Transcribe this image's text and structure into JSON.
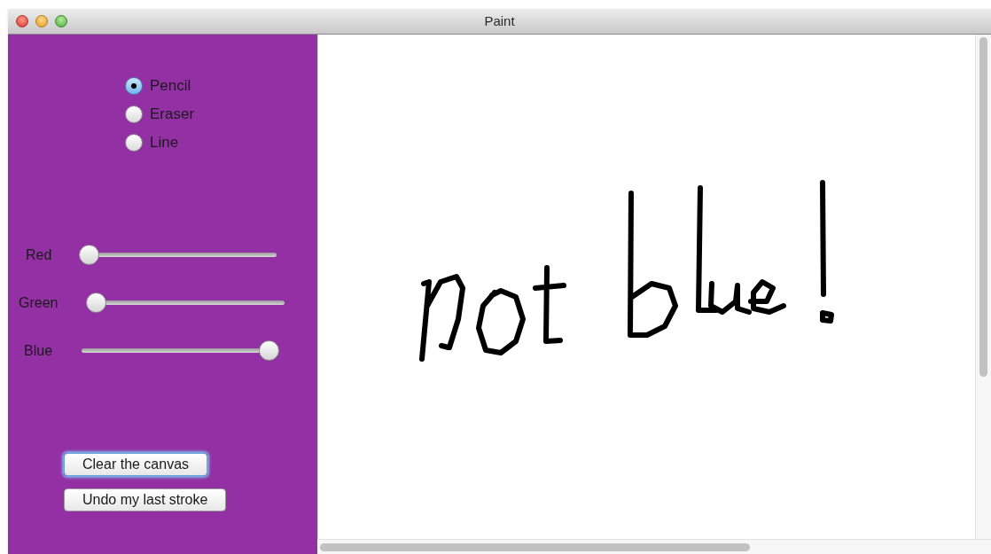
{
  "window": {
    "title": "Paint"
  },
  "tools": [
    {
      "label": "Pencil",
      "selected": true
    },
    {
      "label": "Eraser",
      "selected": false
    },
    {
      "label": "Line",
      "selected": false
    }
  ],
  "sliders": [
    {
      "label": "Red",
      "level": 0
    },
    {
      "label": "Green",
      "level": 0
    },
    {
      "label": "Blue",
      "level": 1
    }
  ],
  "buttons": [
    {
      "label": "Clear the canvas",
      "focused": true
    },
    {
      "label": "Undo my last stroke",
      "focused": false
    }
  ]
}
